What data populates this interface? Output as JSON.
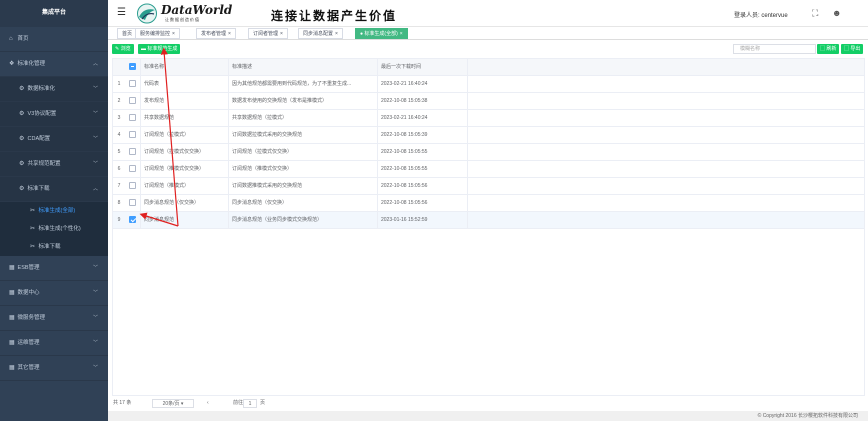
{
  "sidebar": {
    "brand": "集成平台",
    "items": [
      {
        "label": "首页",
        "icon": "home-icon"
      },
      {
        "label": "标准化管理",
        "icon": "standard-icon"
      },
      {
        "label": "数据标准化",
        "icon": "gear-icon"
      },
      {
        "label": "V3协议配置",
        "icon": "gear-icon"
      },
      {
        "label": "CDA配置",
        "icon": "gear-icon"
      },
      {
        "label": "共享规范配置",
        "icon": "gear-icon"
      },
      {
        "label": "标准下载",
        "icon": "gear-icon"
      },
      {
        "label": "标准生成(全部)",
        "icon": "wrench-icon"
      },
      {
        "label": "标准生成(个性化)",
        "icon": "wrench-icon"
      },
      {
        "label": "标准下载",
        "icon": "wrench-icon"
      },
      {
        "label": "ESB管理",
        "icon": "grid-icon"
      },
      {
        "label": "数据中心",
        "icon": "grid-icon"
      },
      {
        "label": "微服务管理",
        "icon": "grid-icon"
      },
      {
        "label": "运维管理",
        "icon": "grid-icon"
      },
      {
        "label": "其它管理",
        "icon": "grid-icon"
      }
    ]
  },
  "header": {
    "logo_text": "DataWorld",
    "logo_sub": "让数据创造价值",
    "slogan": "连接让数据产生价值",
    "login_user": "登录人员:  centervue"
  },
  "tabs": [
    {
      "label": "首页"
    },
    {
      "label": "服务编排监控"
    },
    {
      "label": "发布者管理"
    },
    {
      "label": "订阅者管理"
    },
    {
      "label": "同步消息配置"
    },
    {
      "label": "标准生成(全部)"
    }
  ],
  "toolbar": {
    "browse_label": "浏览",
    "generate_label": "标准规范生成",
    "search_placeholder": "模糊名称",
    "refresh_label": "刷新",
    "export_label": "导出"
  },
  "table": {
    "headers": [
      "标准名称",
      "标准描述",
      "最后一次下载时间"
    ],
    "rows": [
      {
        "no": "1",
        "name": "代码表",
        "desc": "因为其他规范都需要用到代码规范，为了不重复生成...",
        "time": "2023-02-21 16:40:24",
        "checked": false
      },
      {
        "no": "2",
        "name": "发布规范",
        "desc": "数据发布使用的交换规范（发布是推模式）",
        "time": "2022-10-08 15:05:38",
        "checked": false
      },
      {
        "no": "3",
        "name": "共享数据规范",
        "desc": "共享数据规范（拉模式）",
        "time": "2023-02-21 16:40:24",
        "checked": false
      },
      {
        "no": "4",
        "name": "订阅规范（拉模式）",
        "desc": "订阅数据拉模式采用的交换规范",
        "time": "2022-10-08 15:05:39",
        "checked": false
      },
      {
        "no": "5",
        "name": "订阅规范（拉模式仅交换）",
        "desc": "订阅规范（拉模式仅交换）",
        "time": "2022-10-08 15:05:55",
        "checked": false
      },
      {
        "no": "6",
        "name": "订阅规范（推模式仅交换）",
        "desc": "订阅规范（推模式仅交换）",
        "time": "2022-10-08 15:05:55",
        "checked": false
      },
      {
        "no": "7",
        "name": "订阅规范（推模式）",
        "desc": "订阅数据推模式采用的交换规范",
        "time": "2022-10-08 15:05:56",
        "checked": false
      },
      {
        "no": "8",
        "name": "同步消息规范（仅交换）",
        "desc": "同步消息规范（仅交换）",
        "time": "2022-10-08 15:05:56",
        "checked": false
      },
      {
        "no": "9",
        "name": "同步消息规范",
        "desc": "同步消息规范（业务同步模式交换规范）",
        "time": "2023-01-16 15:52:59",
        "checked": true
      }
    ]
  },
  "pager": {
    "total": "共 17 条",
    "page_size": "20条/页",
    "goto_label": "前往",
    "page": "1",
    "page_unit": "页"
  },
  "footer": {
    "copyright": "© Copyright 2016 长沙樱拓软件科技有限公司"
  },
  "colors": {
    "sidebar_bg": "#304156",
    "accent_green": "#13ce66",
    "active_tab": "#42b983",
    "active_link": "#409eff",
    "annotation_red": "#e02020"
  }
}
